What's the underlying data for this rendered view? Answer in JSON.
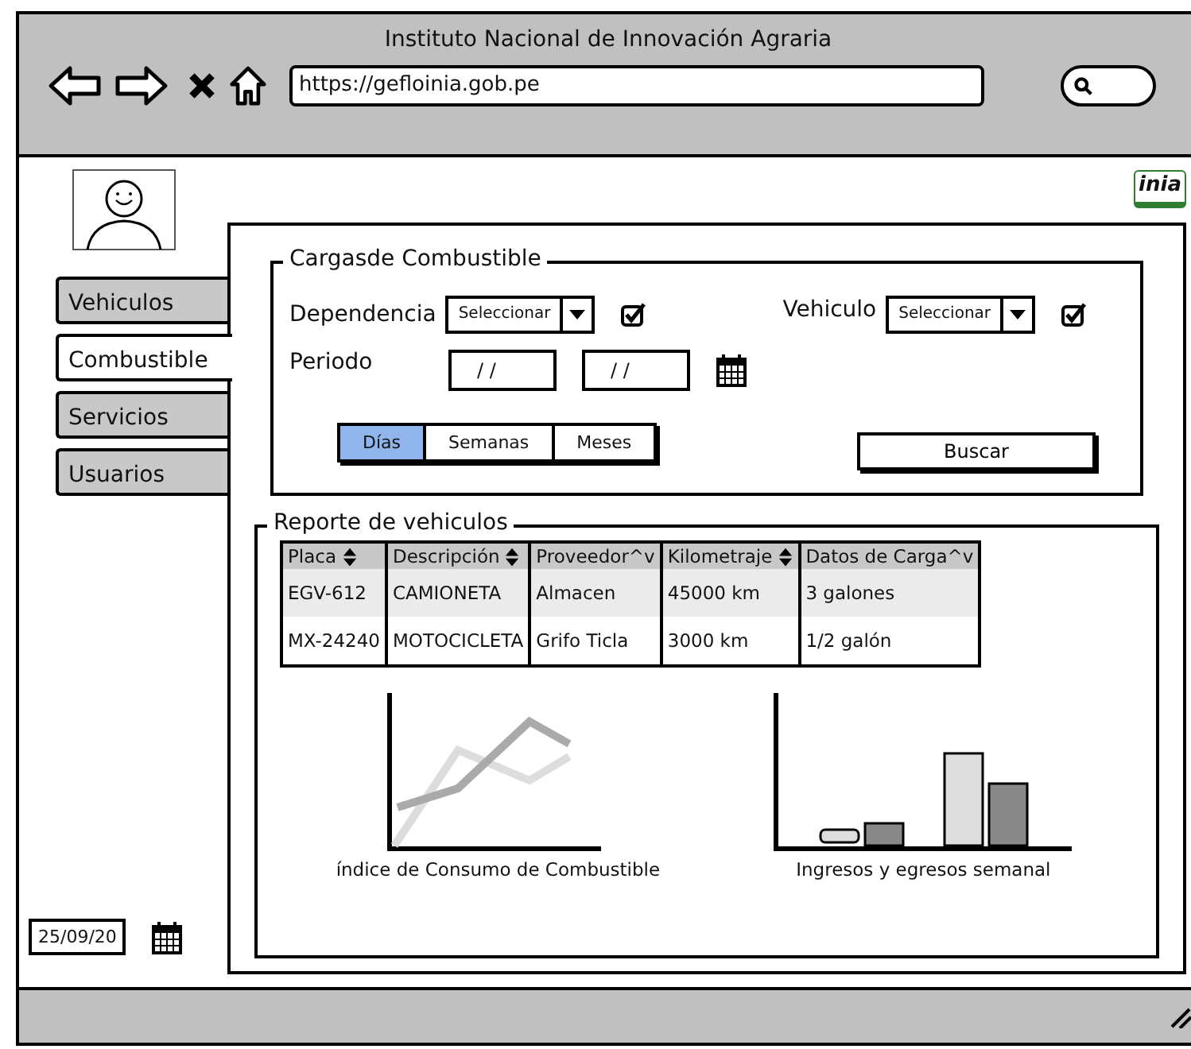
{
  "window": {
    "title": "Instituto Nacional de Innovación Agraria"
  },
  "address_bar": {
    "url": "https://gefloinia.gob.pe"
  },
  "logo": {
    "text": "inia"
  },
  "sidebar": {
    "items": [
      {
        "label": "Vehiculos",
        "selected": false
      },
      {
        "label": "Combustible",
        "selected": true
      },
      {
        "label": "Servicios",
        "selected": false
      },
      {
        "label": "Usuarios",
        "selected": false
      }
    ],
    "date": "25/09/20"
  },
  "filter_panel": {
    "title": "Cargasde Combustible",
    "fields": [
      {
        "label": "Dependencia",
        "value": "Seleccionar",
        "checked": true
      },
      {
        "label": "Vehiculo",
        "value": "Seleccionar",
        "checked": true
      }
    ],
    "period": {
      "label": "Periodo",
      "from": "/ /",
      "to": "/ /"
    },
    "range_tabs": [
      {
        "label": "Días",
        "selected": true
      },
      {
        "label": "Semanas",
        "selected": false
      },
      {
        "label": "Meses",
        "selected": false
      }
    ],
    "search_button": "Buscar"
  },
  "report": {
    "title": "Reporte de vehiculos",
    "table": {
      "columns": [
        {
          "label": "Placa",
          "sortable": true
        },
        {
          "label": "Descripción",
          "sortable": true
        },
        {
          "label": "Proveedor^v",
          "sortable": false
        },
        {
          "label": "Kilometraje",
          "sortable": true
        },
        {
          "label": "Datos de Carga^v",
          "sortable": false
        }
      ],
      "rows": [
        [
          "EGV-612",
          "CAMIONETA",
          "Almacen",
          "45000 km",
          "3 galones"
        ],
        [
          "MX-24240",
          "MOTOCICLETA",
          "Grifo Ticla",
          "3000 km",
          "1/2 galón"
        ]
      ]
    },
    "charts": [
      {
        "kind": "line",
        "caption": "índice de Consumo de Combustible"
      },
      {
        "kind": "bar",
        "caption": "Ingresos y egresos semanal"
      }
    ]
  }
}
